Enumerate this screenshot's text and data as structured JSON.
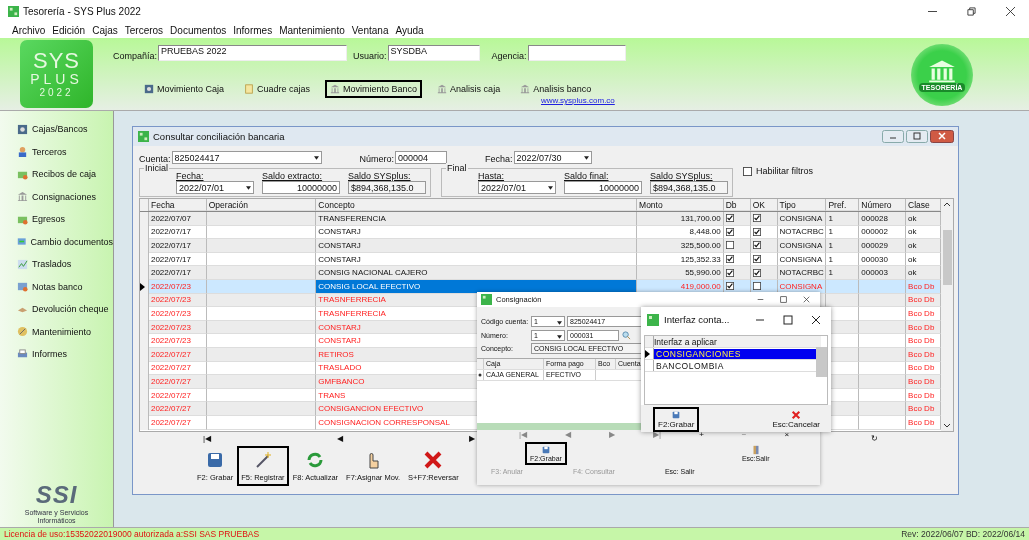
{
  "window": {
    "title": "Tesorería - SYS Plus 2022"
  },
  "menu": [
    "Archivo",
    "Edición",
    "Cajas",
    "Terceros",
    "Documentos",
    "Informes",
    "Mantenimiento",
    "Ventana",
    "Ayuda"
  ],
  "header": {
    "logo": [
      "SYS",
      "PLUS",
      "2022"
    ],
    "company_label": "Compañía:",
    "company": "PRUEBAS 2022",
    "user_label": "Usuario:",
    "user": "SYSDBA",
    "agency_label": "Agencia:",
    "toolbar": [
      {
        "label": "Movimiento Caja",
        "kind": "safe",
        "selected": false
      },
      {
        "label": "Cuadre cajas",
        "kind": "note",
        "selected": false
      },
      {
        "label": "Movimiento Banco",
        "kind": "bank",
        "selected": true
      },
      {
        "label": "Analisis caja",
        "kind": "bank",
        "selected": false
      },
      {
        "label": "Analisis banco",
        "kind": "bank",
        "selected": false
      }
    ],
    "link": "www.sysplus.com.co",
    "badge": "TESORERÍA"
  },
  "sidebar": {
    "items": [
      "Cajas/Bancos",
      "Terceros",
      "Recibos de caja",
      "Consignaciones",
      "Egresos",
      "Cambio documentos",
      "Traslados",
      "Notas banco",
      "Devolución cheque",
      "Mantenimiento",
      "Informes"
    ],
    "logo": "SSI",
    "caption": "Software y Servicios Informáticos"
  },
  "conciliacion": {
    "title": "Consultar conciliación bancaria",
    "cuenta_label": "Cuenta:",
    "cuenta": "825024417",
    "numero_label": "Número:",
    "numero": "000004",
    "fecha_label": "Fecha:",
    "fecha": "2022/07/30",
    "inicial": {
      "legend": "Inicial",
      "fecha_label": "Fecha:",
      "fecha": "2022/07/01",
      "extracto_label": "Saldo extracto:",
      "extracto": "10000000",
      "sys_label": "Saldo SYSplus:",
      "sys": "$894,368,135.0"
    },
    "final": {
      "legend": "Final",
      "fecha_label": "Hasta:",
      "fecha": "2022/07/01",
      "extracto_label": "Saldo final:",
      "extracto": "10000000",
      "sys_label": "Saldo SYSplus:",
      "sys": "$894,368,135.0"
    },
    "filter": {
      "label": "Habilitar filtros",
      "checked": false
    },
    "columns": [
      "Fecha",
      "Operación",
      "Concepto",
      "Monto",
      "Db",
      "OK",
      "Tipo",
      "Pref.",
      "Número",
      "Clase"
    ],
    "rows": [
      {
        "fecha": "2022/07/07",
        "concepto": "TRANSFERENCIA",
        "monto": "131,700.00",
        "db": true,
        "ok": true,
        "tipo": "CONSIGNA",
        "pref": "1",
        "numero": "000028",
        "clase": "ok",
        "pending": false,
        "selected": false
      },
      {
        "fecha": "2022/07/17",
        "concepto": "CONSTARJ",
        "monto": "8,448.00",
        "db": true,
        "ok": true,
        "tipo": "NOTACRBC",
        "pref": "1",
        "numero": "000002",
        "clase": "ok",
        "pending": false,
        "selected": false
      },
      {
        "fecha": "2022/07/17",
        "concepto": "CONSTARJ",
        "monto": "325,500.00",
        "db": false,
        "ok": true,
        "tipo": "CONSIGNA",
        "pref": "1",
        "numero": "000029",
        "clase": "ok",
        "pending": false,
        "selected": false
      },
      {
        "fecha": "2022/07/17",
        "concepto": "CONSTARJ",
        "monto": "125,352.33",
        "db": true,
        "ok": true,
        "tipo": "CONSIGNA",
        "pref": "1",
        "numero": "000030",
        "clase": "ok",
        "pending": false,
        "selected": false
      },
      {
        "fecha": "2022/07/17",
        "concepto": "CONSIG NACIONAL CAJERO",
        "monto": "55,990.00",
        "db": true,
        "ok": true,
        "tipo": "NOTACRBC",
        "pref": "1",
        "numero": "000003",
        "clase": "ok",
        "pending": false,
        "selected": false
      },
      {
        "fecha": "2022/07/23",
        "concepto": "CONSIG LOCAL EFECTIVO",
        "monto": "419,000.00",
        "db": true,
        "ok": false,
        "tipo": "CONSIGNA",
        "clase": "Bco Db",
        "pending": true,
        "selected": true
      },
      {
        "fecha": "2022/07/23",
        "concepto": "TRASNFERRECIA",
        "clase": "Bco Db",
        "pending": true,
        "selected": false
      },
      {
        "fecha": "2022/07/23",
        "concepto": "TRASNFERRECIA",
        "clase": "Bco Db",
        "pending": true,
        "selected": false
      },
      {
        "fecha": "2022/07/23",
        "concepto": "CONSTARJ",
        "clase": "Bco Db",
        "pending": true,
        "selected": false
      },
      {
        "fecha": "2022/07/23",
        "concepto": "CONSTARJ",
        "clase": "Bco Db",
        "pending": true,
        "selected": false
      },
      {
        "fecha": "2022/07/27",
        "concepto": "RETIROS",
        "clase": "Bco Db",
        "pending": true,
        "selected": false
      },
      {
        "fecha": "2022/07/27",
        "concepto": "TRASLADO",
        "clase": "Bco Db",
        "pending": true,
        "selected": false
      },
      {
        "fecha": "2022/07/27",
        "concepto": "GMFBANCO",
        "clase": "Bco Db",
        "pending": true,
        "selected": false
      },
      {
        "fecha": "2022/07/27",
        "concepto": "TRANS",
        "clase": "Bco Db",
        "pending": true,
        "selected": false
      },
      {
        "fecha": "2022/07/27",
        "concepto": "CONSIGANCION EFECTIVO",
        "clase": "Bco Db",
        "pending": true,
        "selected": false
      },
      {
        "fecha": "2022/07/27",
        "concepto": "CONSIGNACION CORRESPONSAL",
        "clase": "Bco Db",
        "pending": true,
        "selected": false
      }
    ],
    "nav": [
      "|◀",
      "◀",
      "▶",
      "↻"
    ],
    "buttons": [
      {
        "label": "F2: Grabar",
        "kind": "save",
        "selected": false
      },
      {
        "label": "F5: Registrar",
        "kind": "wand",
        "selected": true
      },
      {
        "label": "F8: Actualizar",
        "kind": "refresh",
        "selected": false
      },
      {
        "label": "F7:Asignar Mov.",
        "kind": "hand",
        "selected": false
      },
      {
        "label": "S+F7:Reversar",
        "kind": "cancel",
        "selected": false
      }
    ]
  },
  "consignacion": {
    "title": "Consignación",
    "cuenta_label": "Código cuenta:",
    "cuenta_prefix": "1",
    "cuenta": "825024417",
    "numero_label": "Número:",
    "numero_prefix": "1",
    "numero": "000031",
    "concepto_label": "Concepto:",
    "concepto": "CONSIG LOCAL EFECTIVO",
    "columns": [
      "Caja",
      "Forma pago",
      "Bco",
      "Cuenta"
    ],
    "rows": [
      [
        "CAJA GENERAL",
        "EFECTIVO"
      ]
    ],
    "nav": [
      {
        "label": "|◀",
        "disabled": true
      },
      {
        "label": "◀",
        "disabled": true
      },
      {
        "label": "▶",
        "disabled": true
      },
      {
        "label": "▶|",
        "disabled": true
      },
      {
        "label": "+",
        "disabled": false
      },
      {
        "label": "−",
        "disabled": true
      },
      {
        "label": "×",
        "disabled": false
      }
    ],
    "buttons": [
      {
        "label": "F2:Grabar",
        "kind": "save",
        "selected": true
      },
      {
        "label": "Esc:Salir",
        "kind": "book",
        "selected": false
      }
    ],
    "keys": [
      {
        "label": "F3: Anular",
        "disabled": true
      },
      {
        "label": "F4: Consultar",
        "disabled": true
      },
      {
        "label": "Esc: Salir",
        "disabled": false
      }
    ]
  },
  "interfaz": {
    "title": "Interfaz conta...",
    "header": "Interfaz a aplicar",
    "items": [
      {
        "label": "CONSIGANCIONES",
        "selected": true
      },
      {
        "label": "BANCOLOMBIA",
        "selected": false
      }
    ],
    "buttons": [
      {
        "label": "F2:Grabar",
        "kind": "save",
        "selected": true
      },
      {
        "label": "Esc:Cancelar",
        "kind": "cancel",
        "selected": false
      }
    ]
  },
  "status_bar": {
    "license": "Licencia de uso:15352022019000 autorizada a:SSI SAS PRUEBAS",
    "revision": "Rev: 2022/06/07 BD: 2022/06/14"
  }
}
